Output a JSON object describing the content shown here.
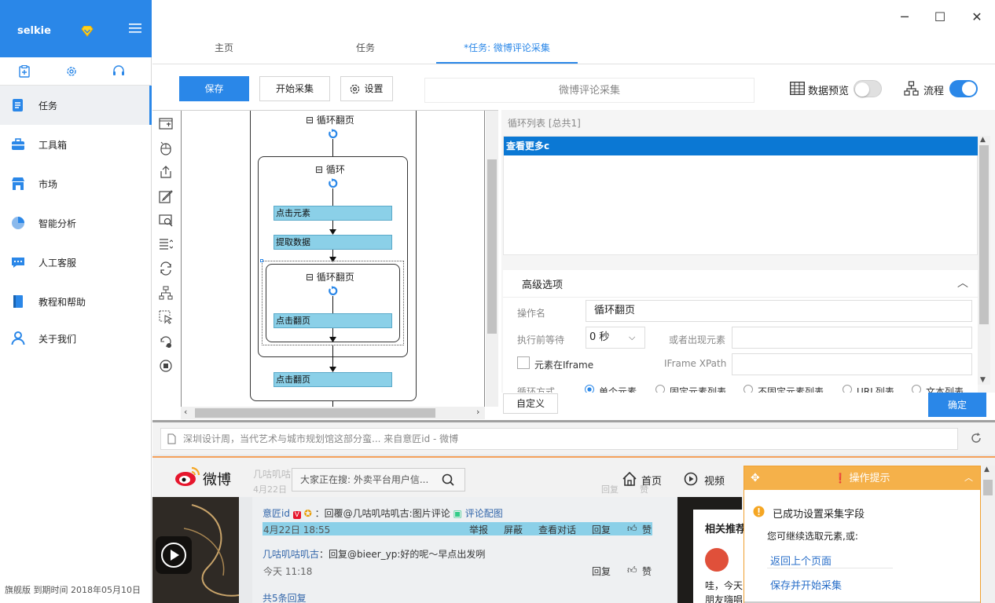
{
  "sidebar": {
    "username": "selkie",
    "items": [
      {
        "label": "任务",
        "icon": "task-icon"
      },
      {
        "label": "工具箱",
        "icon": "toolbox-icon"
      },
      {
        "label": "市场",
        "icon": "market-icon"
      },
      {
        "label": "智能分析",
        "icon": "pie-chart-icon"
      },
      {
        "label": "人工客服",
        "icon": "chat-icon"
      },
      {
        "label": "教程和帮助",
        "icon": "book-icon"
      },
      {
        "label": "关于我们",
        "icon": "user-icon"
      }
    ],
    "footer": "旗舰版  到期时间  2018年05月10日"
  },
  "tabs": [
    "主页",
    "任务",
    "*任务: 微博评论采集"
  ],
  "toolbar": {
    "save": "保存",
    "start": "开始采集",
    "settings": "设置",
    "task_name": "微博评论采集",
    "data_preview": "数据预览",
    "flow": "流程"
  },
  "flow": {
    "loop_page_top": "循环翻页",
    "loop": "循环",
    "step_click": "点击元素",
    "step_extract": "提取数据",
    "loop_page_inner": "循环翻页",
    "step_click_page_inner": "点击翻页",
    "step_click_page_outer": "点击翻页"
  },
  "right_panel": {
    "list_title": "循环列表 [总共1]",
    "list_items": [
      "查看更多c"
    ],
    "advanced": "高级选项",
    "op_name_label": "操作名",
    "op_name_value": "循环翻页",
    "wait_label": "执行前等待",
    "wait_value": "0 秒",
    "or_appear_label": "或者出现元素",
    "iframe_label": "元素在Iframe",
    "iframe_xpath_label": "IFrame XPath",
    "loop_mode_label": "循环方式",
    "loop_modes": [
      "单个元素",
      "固定元素列表",
      "不固定元素列表",
      "URL列表",
      "文本列表"
    ],
    "custom": "自定义",
    "confirm": "确定"
  },
  "url": "深圳设计周，当代艺术与城市规划馆这部分蛮... 来自意匠id - 微博",
  "browser": {
    "logo": "微博",
    "search_placeholder": "大家正在搜: 外卖平台用户信...",
    "nav_home": "首页",
    "nav_video": "视频",
    "comment1_user": "意匠id",
    "comment1_text": "：回覆@几咕叽咕叽古:图片评论",
    "comment1_link": "评论配图",
    "comment1_time": "4月22日 18:55",
    "actions": [
      "举报",
      "屏蔽",
      "查看对话",
      "回复",
      "赞"
    ],
    "comment2_user": "几咕叽咕叽古",
    "comment2_text": "：回复@bieer_yp:好的呢～早点出发咧",
    "comment2_time": "今天 11:18",
    "reply": "回复",
    "like": "赞",
    "more": "共5条回复",
    "faded1": "几咕叽咕",
    "faded2": "4月22日",
    "faded3": "回复",
    "faded4": "赞",
    "side_title": "相关推荐",
    "side_text1": "哇，今天",
    "side_text2": "朋友嗨唱"
  },
  "tip": {
    "title": "操作提示",
    "success": "已成功设置采集字段",
    "hint": "您可继续选取元素,或:",
    "back": "返回上个页面",
    "save_start": "保存并开始采集"
  },
  "colors": {
    "accent": "#2a87e8",
    "selection": "#0b78d4",
    "step": "#8bd0e8",
    "tip": "#f5b14a"
  }
}
